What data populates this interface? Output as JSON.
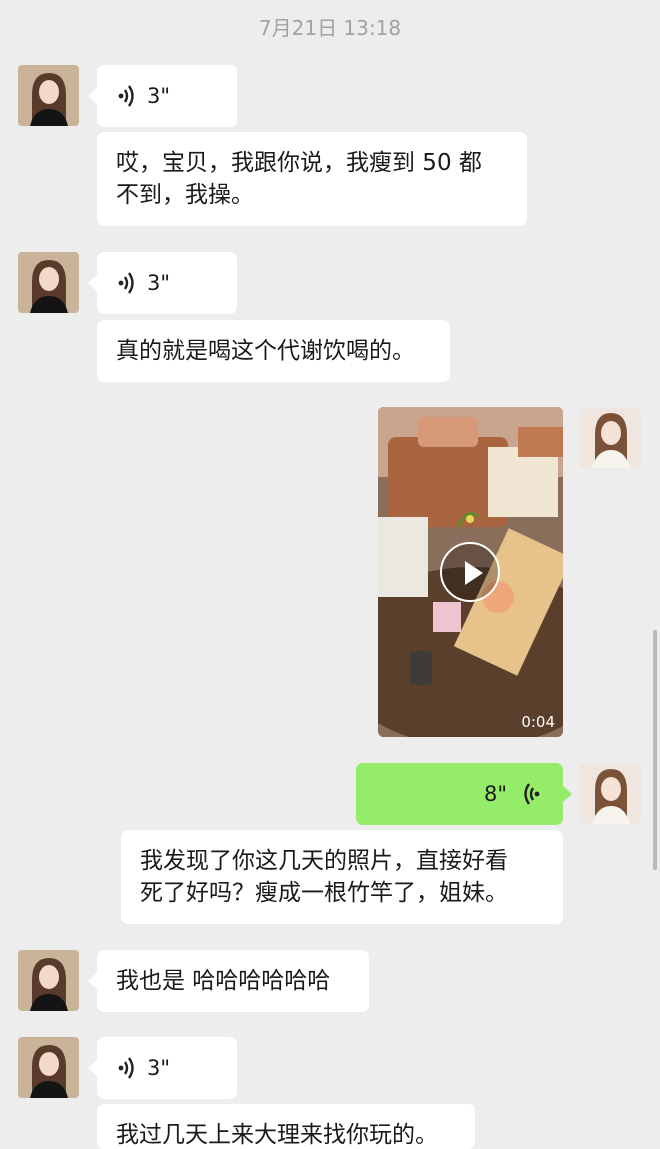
{
  "timestamp": "7月21日 13:18",
  "messages": {
    "m1": {
      "duration": "3\""
    },
    "m2": {
      "line1": "哎，宝贝，我跟你说，我瘦到 50 都",
      "line2": "不到，我操。"
    },
    "m3": {
      "duration": "3\""
    },
    "m4": {
      "text": "真的就是喝这个代谢饮喝的。"
    },
    "m5": {
      "video_duration": "0:04"
    },
    "m6": {
      "duration": "8\""
    },
    "m7": {
      "line1": "我发现了你这几天的照片，直接好看",
      "line2": "死了好吗？瘦成一根竹竿了，姐妹。"
    },
    "m8": {
      "text": "我也是 哈哈哈哈哈哈"
    },
    "m9": {
      "duration": "3\""
    },
    "m10": {
      "text": "我过几天上来大理来找你玩的。"
    }
  },
  "icons": {
    "voice_left": "voice-wave-icon",
    "voice_right": "voice-wave-icon",
    "play": "play-icon"
  },
  "colors": {
    "background": "#ededed",
    "received_bubble": "#ffffff",
    "sent_bubble": "#95ec69"
  }
}
